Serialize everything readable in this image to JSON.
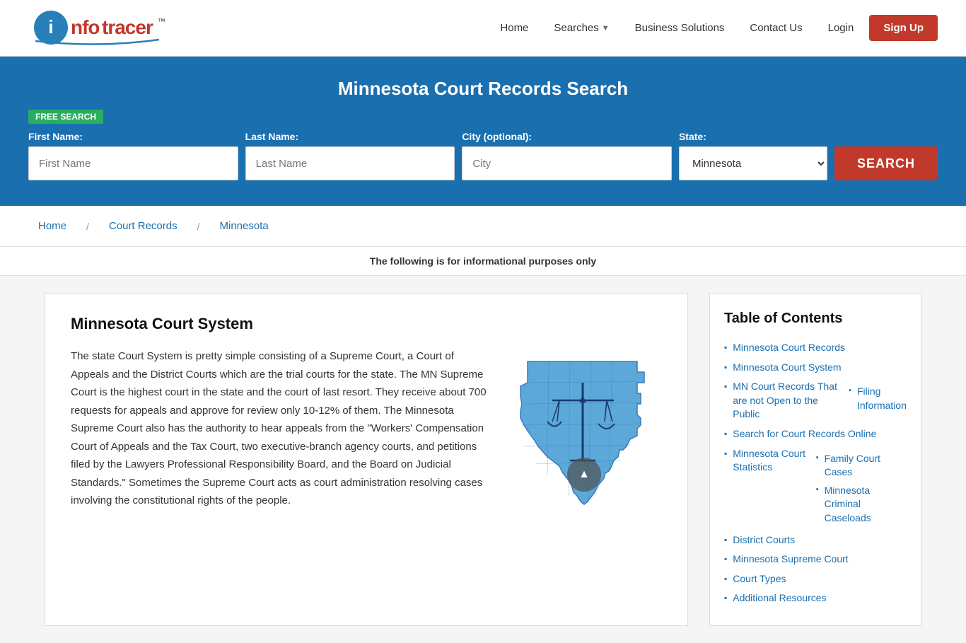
{
  "header": {
    "logo_info": "info",
    "logo_tracer": "tracer",
    "logo_tm": "™",
    "nav_items": [
      {
        "label": "Home",
        "href": "#"
      },
      {
        "label": "Searches",
        "href": "#",
        "has_dropdown": true
      },
      {
        "label": "Business Solutions",
        "href": "#"
      },
      {
        "label": "Contact Us",
        "href": "#"
      },
      {
        "label": "Login",
        "href": "#"
      },
      {
        "label": "Sign Up",
        "href": "#",
        "is_cta": true
      }
    ]
  },
  "hero": {
    "title": "Minnesota Court Records Search",
    "free_badge": "FREE SEARCH",
    "fields": {
      "first_name_label": "First Name:",
      "first_name_placeholder": "First Name",
      "last_name_label": "Last Name:",
      "last_name_placeholder": "Last Name",
      "city_label": "City (optional):",
      "city_placeholder": "City",
      "state_label": "State:",
      "state_value": "Minnesota",
      "search_button": "SEARCH"
    }
  },
  "breadcrumb": {
    "items": [
      {
        "label": "Home",
        "href": "#"
      },
      {
        "label": "Court Records",
        "href": "#"
      },
      {
        "label": "Minnesota",
        "href": "#"
      }
    ]
  },
  "info_bar": {
    "text": "The following is for informational purposes only"
  },
  "article": {
    "heading": "Minnesota Court System",
    "body": "The state Court System is pretty simple consisting of a Supreme Court, a Court of Appeals and the District Courts which are the trial courts for the state. The MN Supreme Court is the highest court in the state and the court of last resort. They receive about 700 requests for appeals and approve for review only 10-12% of them. The Minnesota Supreme Court also has the authority to hear appeals from the \"Workers' Compensation Court of Appeals and the Tax Court, two executive-branch agency courts, and petitions filed by the Lawyers Professional Responsibility Board, and the Board on Judicial Standards.\" Sometimes the Supreme Court acts as court administration resolving cases involving the constitutional rights of the people."
  },
  "toc": {
    "title": "Table of Contents",
    "items": [
      {
        "label": "Minnesota Court Records",
        "href": "#",
        "sub": []
      },
      {
        "label": "Minnesota Court System",
        "href": "#",
        "sub": []
      },
      {
        "label": "MN Court Records That are not Open to the Public",
        "href": "#",
        "sub": [
          {
            "label": "Filing Information",
            "href": "#"
          }
        ]
      },
      {
        "label": "Search for Court Records Online",
        "href": "#",
        "sub": []
      },
      {
        "label": "Minnesota Court Statistics",
        "href": "#",
        "sub": [
          {
            "label": "Family Court Cases",
            "href": "#"
          },
          {
            "label": "Minnesota Criminal Caseloads",
            "href": "#"
          }
        ]
      },
      {
        "label": "District Courts",
        "href": "#",
        "sub": []
      },
      {
        "label": "Minnesota Supreme Court",
        "href": "#",
        "sub": []
      },
      {
        "label": "Court Types",
        "href": "#",
        "sub": []
      },
      {
        "label": "Additional Resources",
        "href": "#",
        "sub": []
      }
    ]
  }
}
